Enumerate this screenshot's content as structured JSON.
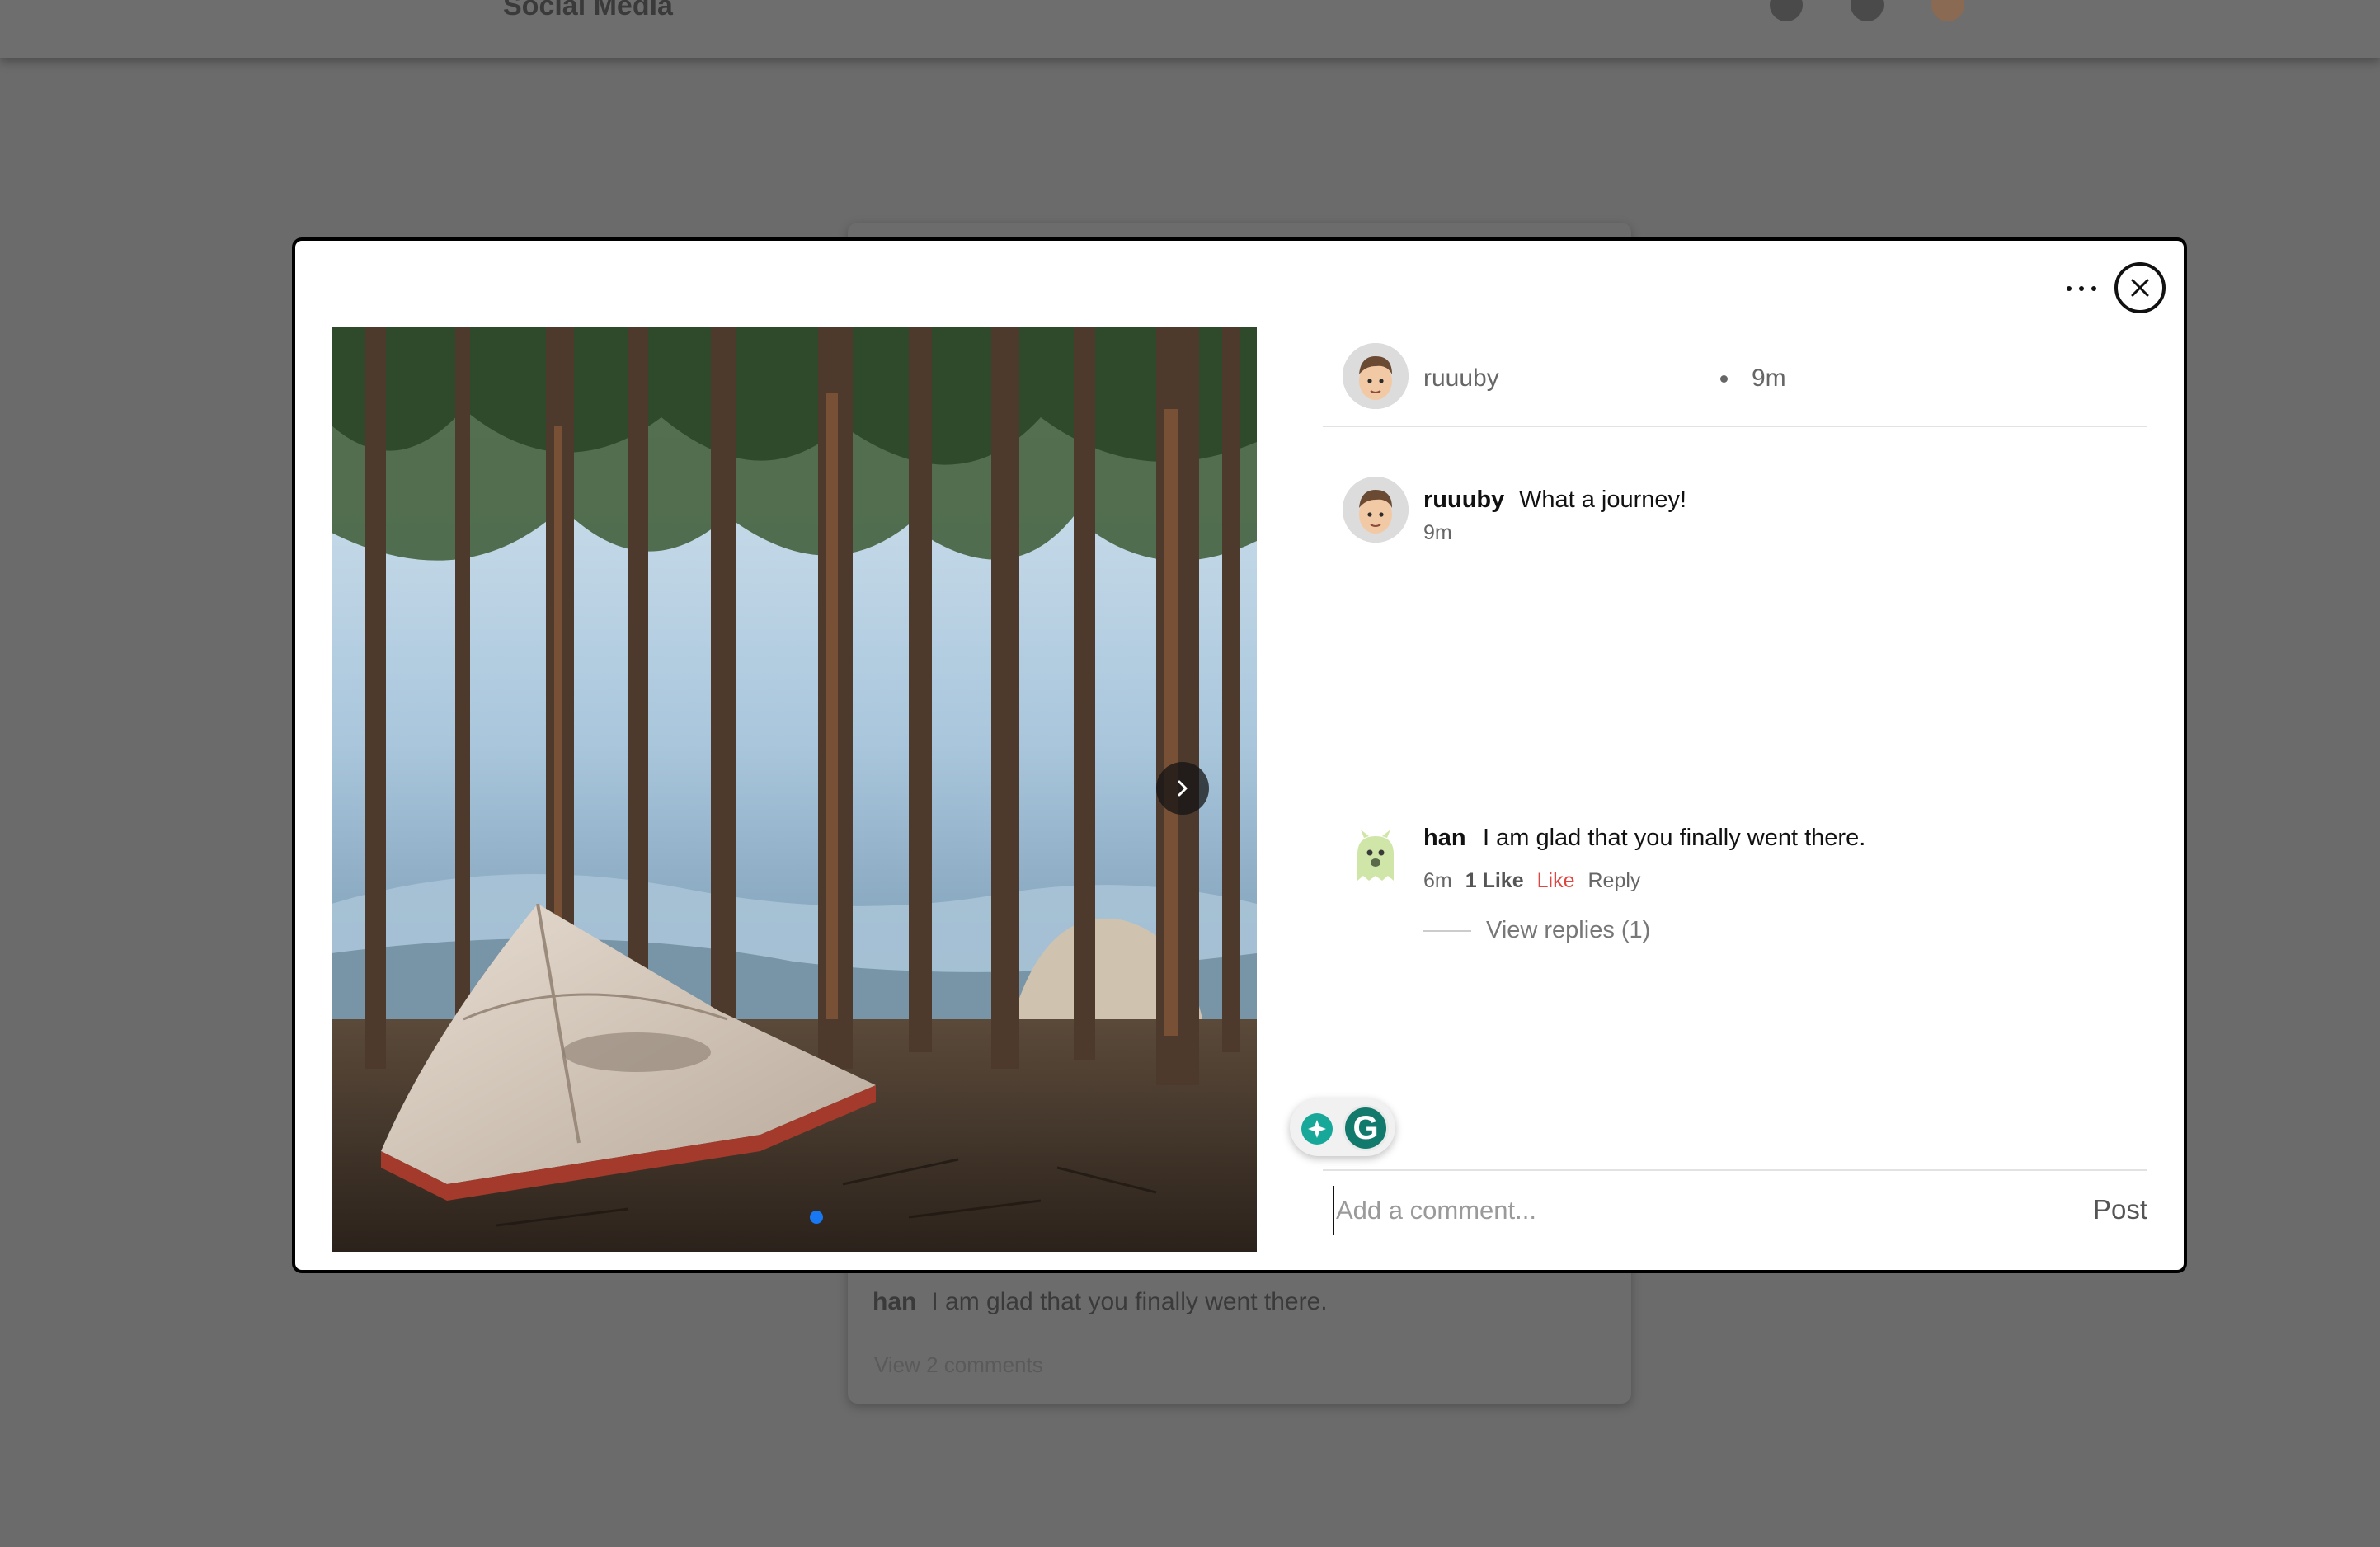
{
  "background": {
    "brand": "Social Media",
    "preview_comment_user": "han",
    "preview_comment_text": "I am glad that you finally went there.",
    "view_all": "View 2 comments"
  },
  "post": {
    "author": "ruuuby",
    "time": "9m",
    "image_count": 1,
    "active_image": 1
  },
  "caption": {
    "user": "ruuuby",
    "text": "What a journey!",
    "time": "9m"
  },
  "comments": [
    {
      "user": "han",
      "text": "I am glad that you finally went there.",
      "time": "6m",
      "likes": "1 Like",
      "like_label": "Like",
      "reply_label": "Reply",
      "view_replies": "View replies (1)"
    }
  ],
  "comment_box": {
    "placeholder": "Add a comment...",
    "post_label": "Post"
  },
  "colors": {
    "like_active": "#e0463f",
    "carousel_dot": "#1877f2",
    "grammarly": "#127a6c"
  },
  "icons": [
    "more-icon",
    "close-icon",
    "chevron-right-icon",
    "grammarly-icon"
  ]
}
